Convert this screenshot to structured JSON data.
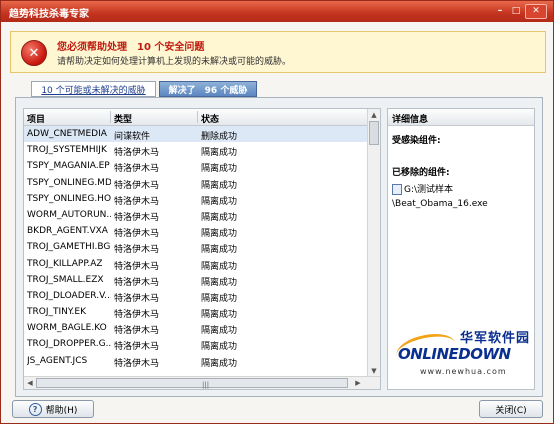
{
  "window": {
    "title": "趋势科技杀毒专家"
  },
  "titlebar": {
    "min_icon": "minimize-icon",
    "max_icon": "maximize-icon",
    "close_icon": "close-icon"
  },
  "alert": {
    "title": "您必须帮助处理　10 个安全问题",
    "subtitle": "请帮助决定如何处理计算机上发现的未解决或可能的威胁。",
    "icon": "error-x-icon",
    "icon_glyph": "✕"
  },
  "tabs": [
    {
      "label": "10 个可能或未解决的威胁",
      "active": false
    },
    {
      "label": "解决了　96 个威胁",
      "active": true
    }
  ],
  "list": {
    "columns": [
      "项目",
      "类型",
      "状态"
    ],
    "rows": [
      {
        "name": "ADW_CNETMEDIA",
        "type": "间谍软件",
        "status": "删除成功"
      },
      {
        "name": "TROJ_SYSTEMHIJK",
        "type": "特洛伊木马",
        "status": "隔离成功"
      },
      {
        "name": "TSPY_MAGANIA.EP",
        "type": "特洛伊木马",
        "status": "隔离成功"
      },
      {
        "name": "TSPY_ONLINEG.MDX",
        "type": "特洛伊木马",
        "status": "隔离成功"
      },
      {
        "name": "TSPY_ONLINEG.HOZ",
        "type": "特洛伊木马",
        "status": "隔离成功"
      },
      {
        "name": "WORM_AUTORUN....",
        "type": "特洛伊木马",
        "status": "隔离成功"
      },
      {
        "name": "BKDR_AGENT.VXA",
        "type": "特洛伊木马",
        "status": "隔离成功"
      },
      {
        "name": "TROJ_GAMETHI.BGM",
        "type": "特洛伊木马",
        "status": "隔离成功"
      },
      {
        "name": "TROJ_KILLAPP.AZ",
        "type": "特洛伊木马",
        "status": "隔离成功"
      },
      {
        "name": "TROJ_SMALL.EZX",
        "type": "特洛伊木马",
        "status": "隔离成功"
      },
      {
        "name": "TROJ_DLOADER.V...",
        "type": "特洛伊木马",
        "status": "隔离成功"
      },
      {
        "name": "TROJ_TINY.EK",
        "type": "特洛伊木马",
        "status": "隔离成功"
      },
      {
        "name": "WORM_BAGLE.KO",
        "type": "特洛伊木马",
        "status": "隔离成功"
      },
      {
        "name": "TROJ_DROPPER.G...",
        "type": "特洛伊木马",
        "status": "隔离成功"
      },
      {
        "name": "JS_AGENT.JCS",
        "type": "特洛伊木马",
        "status": "隔离成功"
      }
    ],
    "scroll_grip": "|||"
  },
  "details": {
    "header": "详细信息",
    "infected_label": "受感染组件:",
    "removed_label": "已移除的组件:",
    "removed_path_1": "G:\\测试样本",
    "removed_path_2": "\\Beat_Obama_16.exe"
  },
  "watermark": {
    "cn": "华军软件园",
    "en": "ONLINEDOWN",
    "url": "www.newhua.com"
  },
  "footer": {
    "help_label": "帮助(H)",
    "close_label": "关闭(C)"
  },
  "colors": {
    "titlebar": "#c4331f",
    "alert_title": "#c01a10",
    "active_tab": "#5b86c0",
    "selected_row": "#dce8f5",
    "logo_blue": "#0a2f8f",
    "logo_orange": "#f2a318"
  }
}
